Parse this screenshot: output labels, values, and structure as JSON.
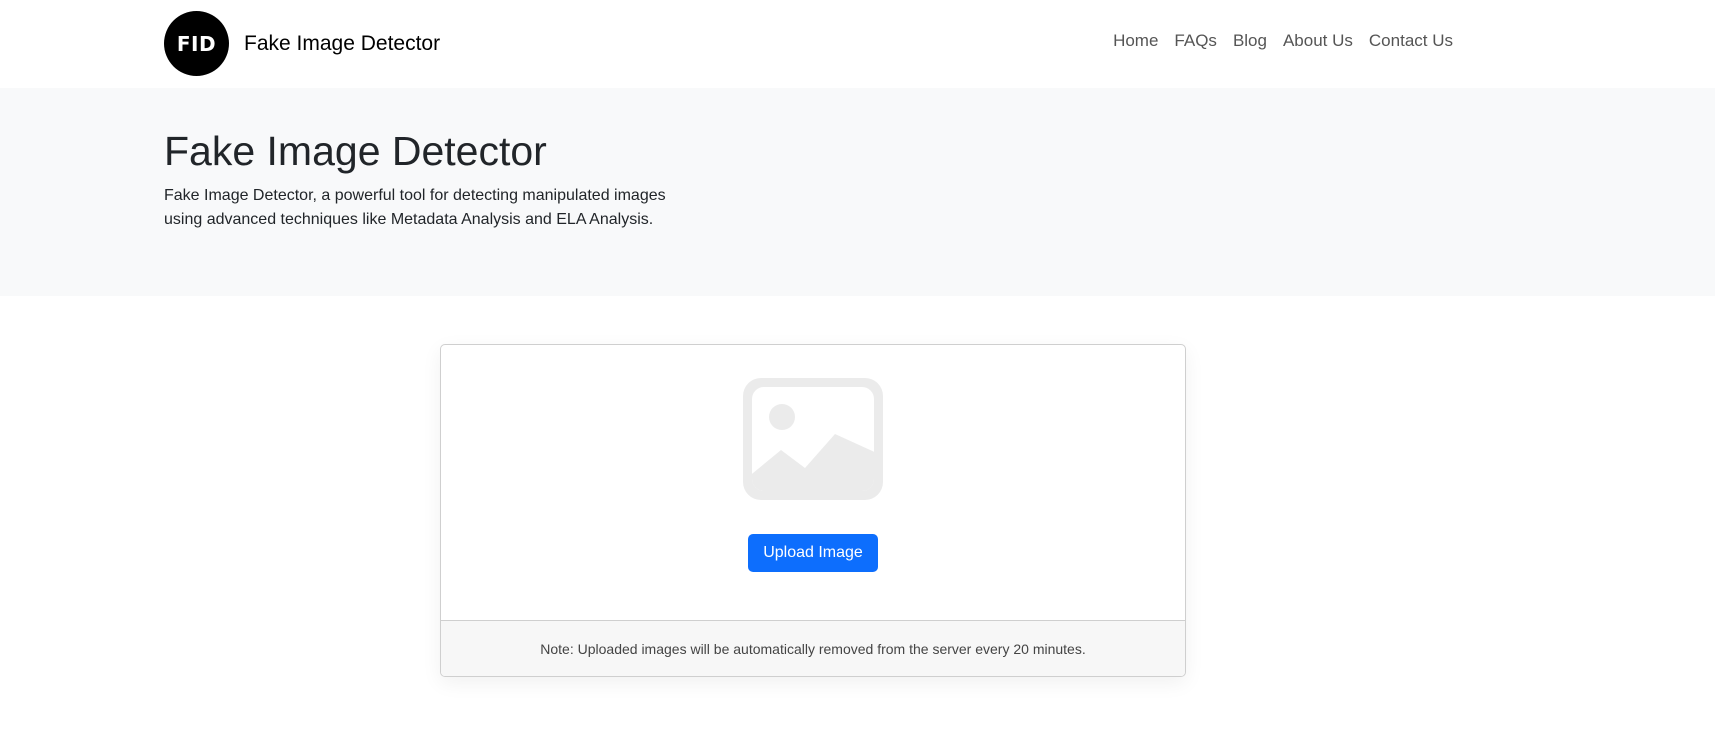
{
  "navbar": {
    "logo_text": "FID",
    "brand_name": "Fake Image Detector",
    "links": [
      {
        "label": "Home"
      },
      {
        "label": "FAQs"
      },
      {
        "label": "Blog"
      },
      {
        "label": "About Us"
      },
      {
        "label": "Contact Us"
      }
    ]
  },
  "hero": {
    "title": "Fake Image Detector",
    "description": "Fake Image Detector, a powerful tool for detecting manipulated images using advanced techniques like Metadata Analysis and ELA Analysis."
  },
  "upload_card": {
    "placeholder_icon": "image-icon",
    "upload_label": "Upload Image",
    "note": "Note: Uploaded images will be automatically removed from the server every 20 minutes."
  },
  "colors": {
    "primary": "#0d6efd",
    "hero_bg": "#f8f9fa",
    "logo_bg": "#000000",
    "placeholder": "#ebebeb"
  }
}
